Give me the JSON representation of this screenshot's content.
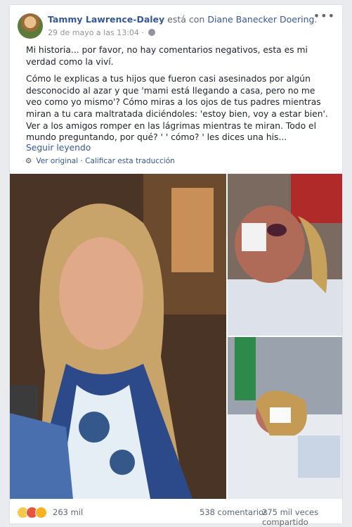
{
  "post": {
    "author": "Tammy Lawrence-Daley",
    "with_text": " está con ",
    "tagged": "Diane Banecker Doering",
    "tagged_suffix": ".",
    "date": "29 de mayo a las 13:04 · ",
    "more_icon": "more-horizontal-icon",
    "paragraph1": "Mi historia... por favor, no hay comentarios negativos, esta es mi verdad como la viví.",
    "paragraph2": "Cómo le explicas a tus hijos que fueron casi asesinados por algún desconocido al azar y que 'mami está llegando a casa, pero no me veo como yo mismo'? Cómo miras a los ojos de tus padres mientras miran a tu cara maltratada diciéndoles: 'estoy bien, voy a estar bien'. Ver a los amigos romper en las lágrimas mientras te miran. Todo el mundo preguntando, por qué? ' ' cómo? ' les dices una his...",
    "see_more": "Seguir leyendo",
    "see_original": "Ver original",
    "separator": " · ",
    "rate_translation": "Calificar esta traducción"
  },
  "footer": {
    "reaction_count": "263 mil",
    "comments": "538 comentarios",
    "shares": "275 mil veces compartido"
  },
  "colors": {
    "link": "#365899",
    "muted": "#90949c"
  }
}
